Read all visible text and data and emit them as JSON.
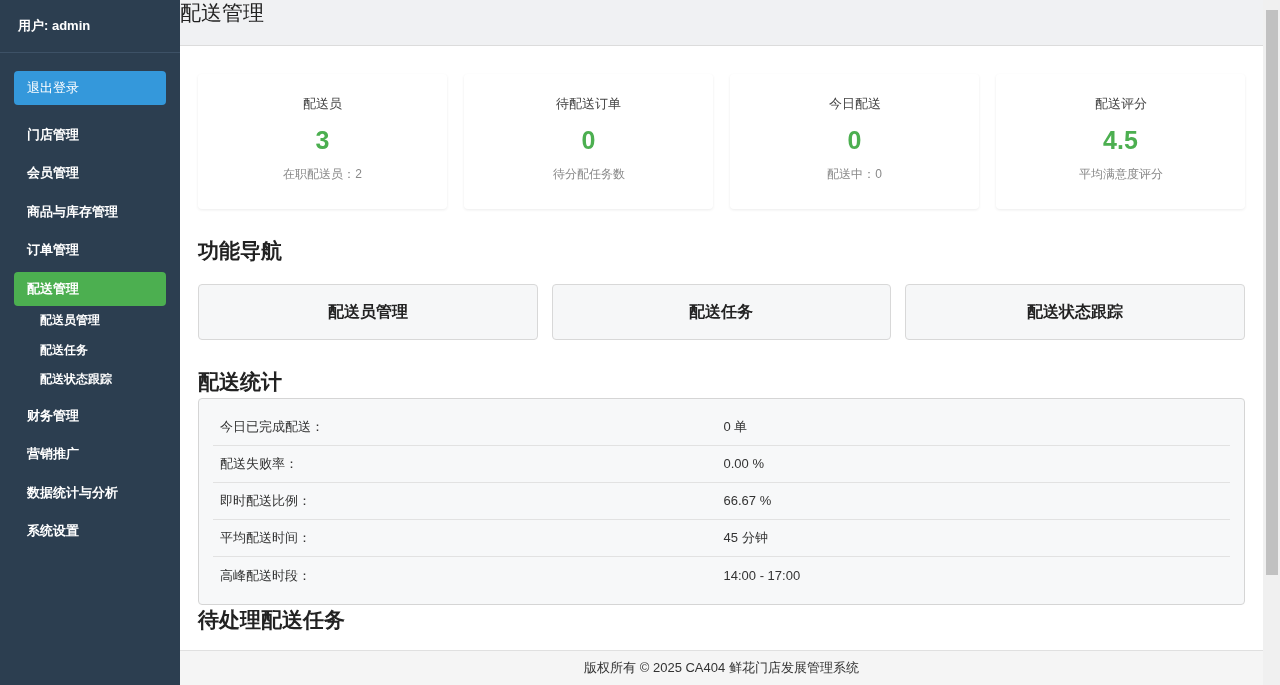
{
  "sidebar": {
    "user": "用户: admin",
    "logout": "退出登录",
    "items": [
      {
        "label": "门店管理",
        "selected": false
      },
      {
        "label": "会员管理",
        "selected": false
      },
      {
        "label": "商品与库存管理",
        "selected": false
      },
      {
        "label": "订单管理",
        "selected": false
      },
      {
        "label": "配送管理",
        "selected": true,
        "children": [
          {
            "label": "配送员管理"
          },
          {
            "label": "配送任务"
          },
          {
            "label": "配送状态跟踪"
          }
        ]
      },
      {
        "label": "财务管理",
        "selected": false
      },
      {
        "label": "营销推广",
        "selected": false
      },
      {
        "label": "数据统计与分析",
        "selected": false
      },
      {
        "label": "系统设置",
        "selected": false
      }
    ]
  },
  "page_title": "配送管理",
  "stat_cards": [
    {
      "title": "配送员",
      "value": "3",
      "note": "在职配送员：2"
    },
    {
      "title": "待配送订单",
      "value": "0",
      "note": "待分配任务数"
    },
    {
      "title": "今日配送",
      "value": "0",
      "note": "配送中：0"
    },
    {
      "title": "配送评分",
      "value": "4.5",
      "note": "平均满意度评分"
    }
  ],
  "nav": {
    "heading": "功能导航",
    "buttons": [
      "配送员管理",
      "配送任务",
      "配送状态跟踪"
    ]
  },
  "stats": {
    "heading": "配送统计",
    "rows": [
      {
        "label": "今日已完成配送：",
        "value": "0 单"
      },
      {
        "label": "配送失败率：",
        "value": "0.00 %"
      },
      {
        "label": "即时配送比例：",
        "value": "66.67 %"
      },
      {
        "label": "平均配送时间：",
        "value": "45 分钟"
      },
      {
        "label": "高峰配送时段：",
        "value": "14:00 - 17:00"
      }
    ]
  },
  "next_heading": "待处理配送任务",
  "footer": "版权所有 © 2025 CA404 鲜花门店发展管理系统"
}
